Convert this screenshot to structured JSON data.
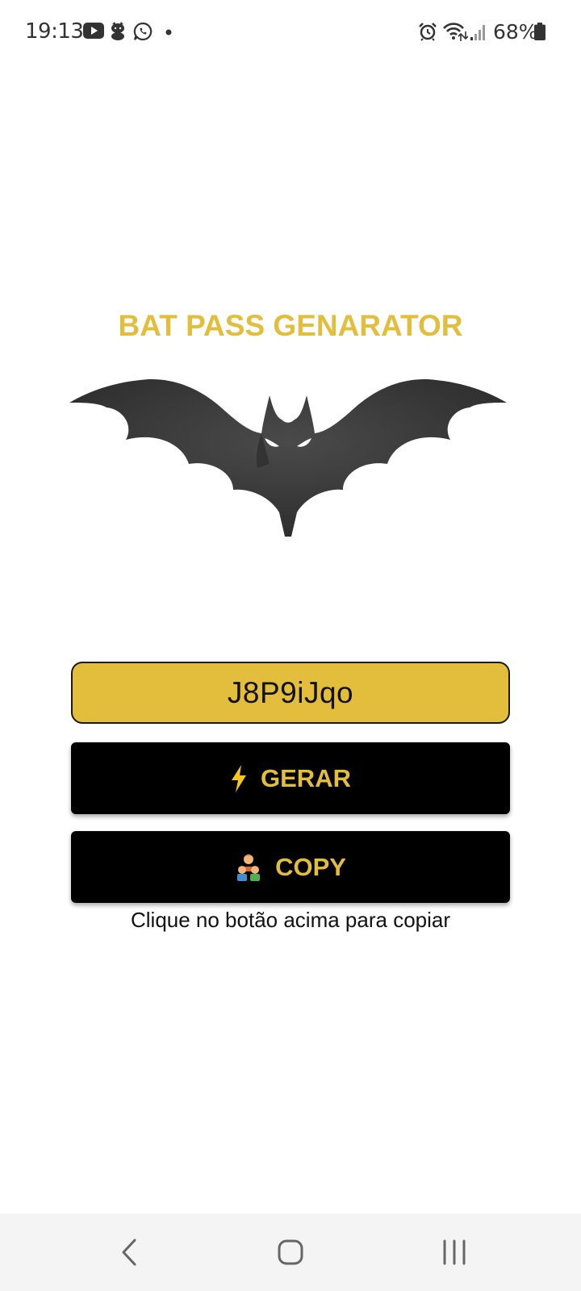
{
  "status_bar": {
    "time": "19:13",
    "battery_percent": "68%",
    "notification_icons": [
      "youtube-icon",
      "hello-kitty-icon",
      "whatsapp-icon",
      "dot-icon"
    ],
    "system_icons": [
      "alarm-icon",
      "wifi-icon",
      "signal-icon",
      "battery-icon"
    ]
  },
  "app": {
    "title": "BAT PASS GENARATOR",
    "logo": "bat-icon",
    "password": "J8P9iJqo",
    "generate_label": "GERAR",
    "generate_icon": "lightning-icon",
    "copy_label": "COPY",
    "copy_icon": "people-icon",
    "copy_hint": "Clique no botão acima para copiar"
  },
  "colors": {
    "accent": "#e3bd3c",
    "button_bg": "#000000",
    "bat": "#3c3c3c"
  },
  "nav_bar": {
    "buttons": [
      "back-icon",
      "home-icon",
      "recents-icon"
    ]
  }
}
